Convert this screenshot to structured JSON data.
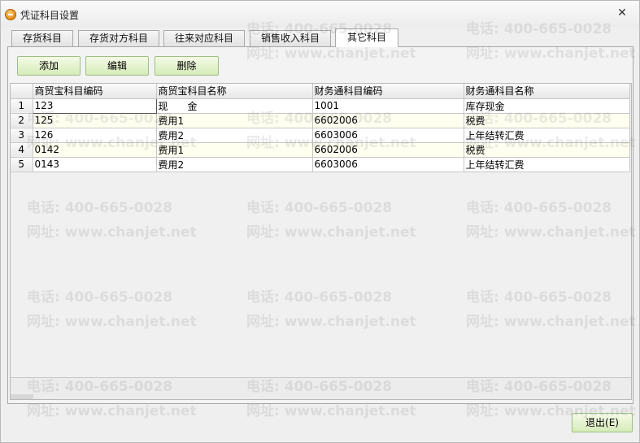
{
  "window": {
    "title": "凭证科目设置",
    "close_glyph": "✕"
  },
  "tabs": [
    {
      "label": "存货科目"
    },
    {
      "label": "存货对方科目"
    },
    {
      "label": "往来对应科目"
    },
    {
      "label": "销售收入科目"
    },
    {
      "label": "其它科目",
      "active": true
    }
  ],
  "toolbar": {
    "add_label": "添加",
    "edit_label": "编辑",
    "delete_label": "删除"
  },
  "table": {
    "columns": [
      "商贸宝科目编码",
      "商贸宝科目名称",
      "财务通科目编码",
      "财务通科目名称"
    ],
    "rows": [
      {
        "num": "1",
        "code": "123",
        "name": "现　　金",
        "fin_code": "1001",
        "fin_name": "库存现金"
      },
      {
        "num": "2",
        "code": "125",
        "name": "费用1",
        "fin_code": "6602006",
        "fin_name": "税费"
      },
      {
        "num": "3",
        "code": "126",
        "name": "费用2",
        "fin_code": "6603006",
        "fin_name": "上年结转汇费"
      },
      {
        "num": "4",
        "code": "0142",
        "name": "费用1",
        "fin_code": "6602006",
        "fin_name": "税费"
      },
      {
        "num": "5",
        "code": "0143",
        "name": "费用2",
        "fin_code": "6603006",
        "fin_name": "上年结转汇费"
      }
    ]
  },
  "footer": {
    "exit_label": "退出(E)"
  },
  "watermark": {
    "phone": "电话: 400-665-0028",
    "site": "网址: www.chanjet.net"
  },
  "colors": {
    "button_border": "#9dbf84",
    "button_fill": "#d6ebb8",
    "row_alt": "#fffff0"
  }
}
